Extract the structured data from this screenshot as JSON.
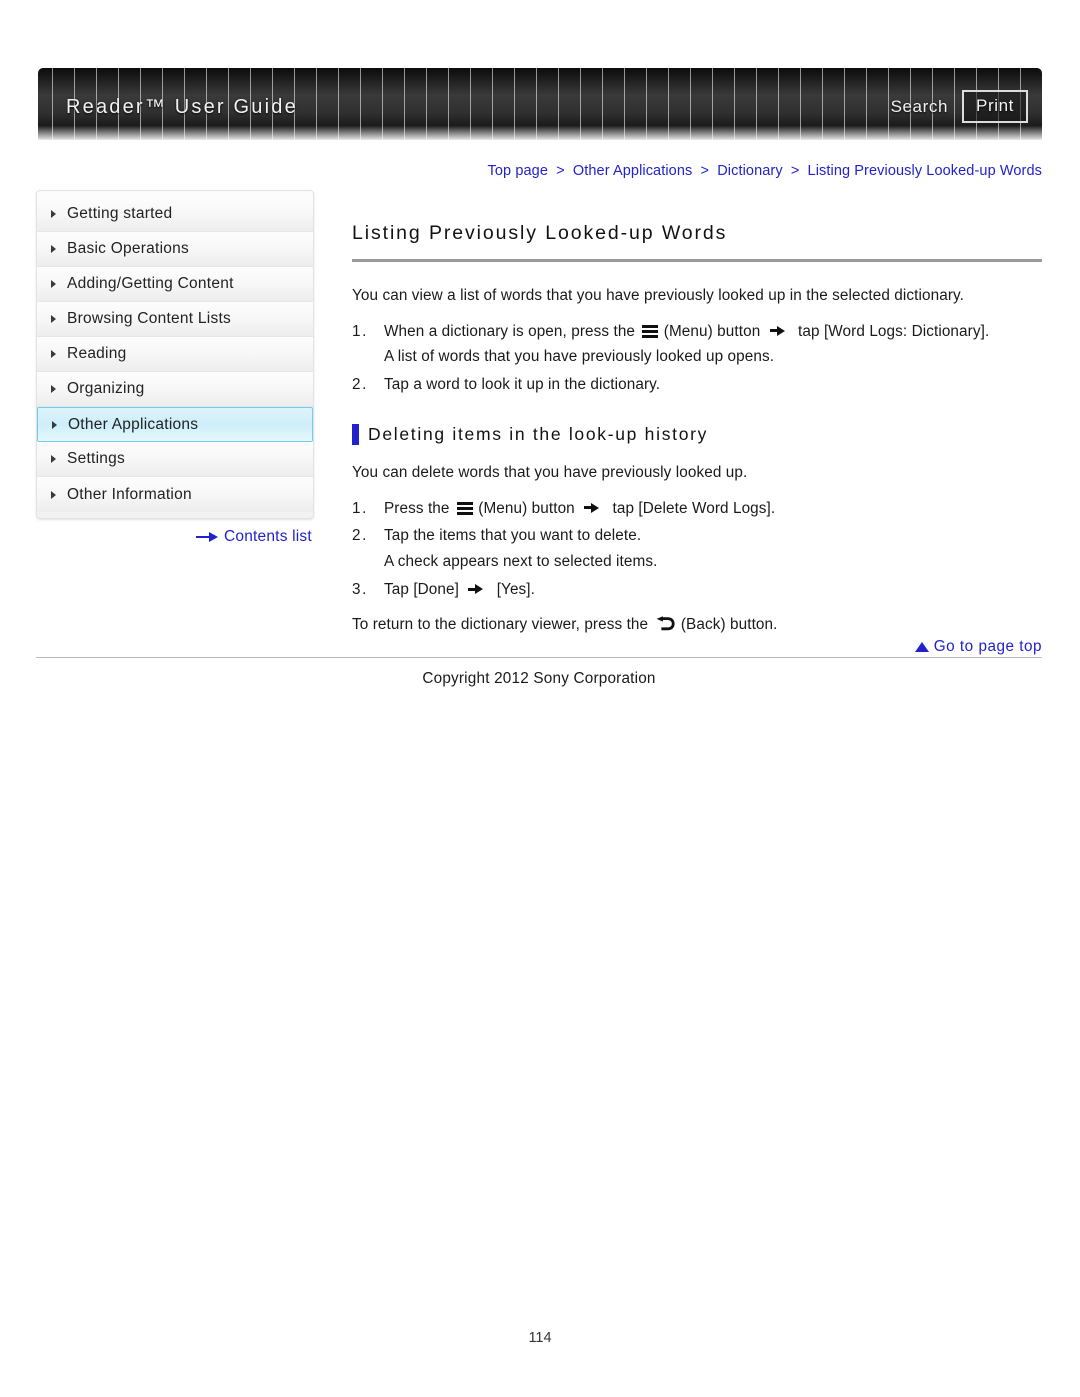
{
  "header": {
    "title": "Reader™ User Guide",
    "search_label": "Search",
    "print_label": "Print"
  },
  "breadcrumb": {
    "items": [
      "Top page",
      "Other Applications",
      "Dictionary",
      "Listing Previously Looked-up Words"
    ],
    "separator": ">"
  },
  "sidebar": {
    "items": [
      {
        "label": "Getting started",
        "active": false
      },
      {
        "label": "Basic Operations",
        "active": false
      },
      {
        "label": "Adding/Getting Content",
        "active": false
      },
      {
        "label": "Browsing Content Lists",
        "active": false
      },
      {
        "label": "Reading",
        "active": false
      },
      {
        "label": "Organizing",
        "active": false
      },
      {
        "label": "Other Applications",
        "active": true
      },
      {
        "label": "Settings",
        "active": false
      },
      {
        "label": "Other Information",
        "active": false
      }
    ],
    "contents_list_label": "Contents list"
  },
  "main": {
    "page_title": "Listing Previously Looked-up Words",
    "intro": "You can view a list of words that you have previously looked up in the selected dictionary.",
    "steps": [
      {
        "num": "1.",
        "before_icon": "When a dictionary is open, press the",
        "icon": "menu-icon",
        "after_icon": "(Menu) button",
        "after_arrow": "tap [Word Logs: Dictionary].",
        "sub": "A list of words that you have previously looked up opens."
      },
      {
        "num": "2.",
        "before_icon": "Tap a word to look it up in the dictionary.",
        "icon": "",
        "after_icon": "",
        "after_arrow": "",
        "sub": ""
      }
    ],
    "subsection": {
      "heading": "Deleting items in the look-up history",
      "intro": "You can delete words that you have previously looked up.",
      "steps": [
        {
          "num": "1.",
          "before_icon": "Press the",
          "icon": "menu-icon",
          "after_icon": "(Menu) button",
          "after_arrow": "tap [Delete Word Logs].",
          "sub": ""
        },
        {
          "num": "2.",
          "before_icon": "Tap the items that you want to delete.",
          "icon": "",
          "after_icon": "",
          "after_arrow": "",
          "sub": "A check appears next to selected items."
        },
        {
          "num": "3.",
          "before_icon": "Tap [Done]",
          "icon": "",
          "after_icon": "",
          "after_arrow": "[Yes].",
          "sub": ""
        }
      ],
      "closing_before": "To return to the dictionary viewer, press the",
      "closing_icon": "back-icon",
      "closing_after": "(Back) button."
    },
    "go_to_top_label": "Go to page top"
  },
  "footer": {
    "copyright": "Copyright 2012 Sony Corporation",
    "page_number": "114"
  },
  "colors": {
    "link": "#2222CC",
    "accent_bar": "#2222CC",
    "active_nav_bg": "#CDEEFA",
    "active_nav_border": "#6FCFE8",
    "title_rule": "#9A9A9A"
  }
}
